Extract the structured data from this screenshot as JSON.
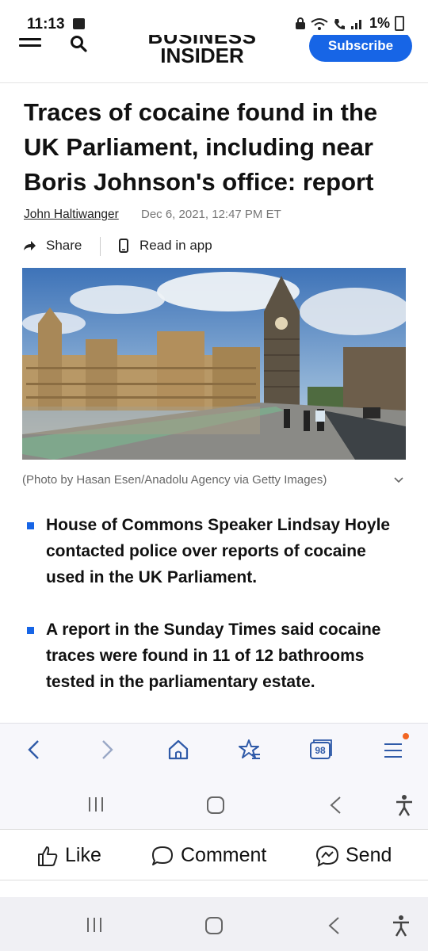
{
  "status_bar": {
    "time": "11:13",
    "battery": "1%"
  },
  "header": {
    "logo_line1": "BUSINESS",
    "logo_line2": "INSIDER",
    "subscribe_label": "Subscribe"
  },
  "article": {
    "title": "Traces of cocaine found in the UK Parliament, including near Boris Johnson's office: report",
    "author": "John Haltiwanger",
    "date": "Dec 6, 2021, 12:47 PM ET",
    "share_label": "Share",
    "read_in_app_label": "Read in app",
    "photo_caption": "(Photo by Hasan Esen/Anadolu Agency via Getty Images)",
    "bullets": [
      "House of Commons Speaker Lindsay Hoyle contacted police over reports of cocaine used in the UK Parliament.",
      "A report in the Sunday Times said cocaine traces were found in 11 of 12 bathrooms tested in the parliamentary estate."
    ]
  },
  "browser_toolbar": {
    "tab_count": "98",
    "accent_color": "#1765e6",
    "notification_dot_color": "#f26522"
  },
  "facebook_bar": {
    "like_label": "Like",
    "comment_label": "Comment",
    "send_label": "Send"
  }
}
